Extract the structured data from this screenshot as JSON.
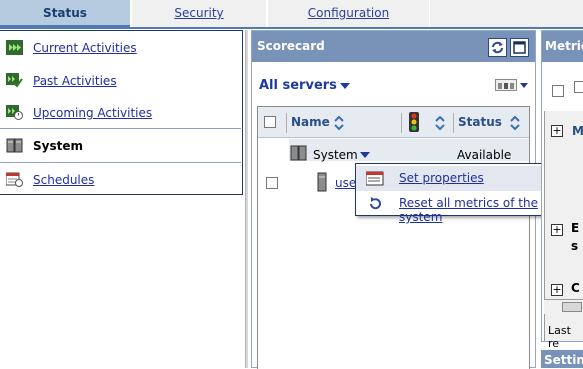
{
  "tabs": [
    {
      "label": "Status"
    },
    {
      "label": "Security"
    },
    {
      "label": "Configuration"
    }
  ],
  "nav": {
    "items": [
      {
        "label": "Current Activities",
        "icon": "current-activities-icon"
      },
      {
        "label": "Past Activities",
        "icon": "past-activities-icon"
      },
      {
        "label": "Upcoming Activities",
        "icon": "upcoming-activities-icon"
      },
      {
        "label": "System",
        "icon": "system-icon",
        "selected": true
      },
      {
        "label": "Schedules",
        "icon": "schedules-icon"
      }
    ]
  },
  "scorecard": {
    "title": "Scorecard",
    "servers_filter": "All servers",
    "columns": {
      "name": "Name",
      "status": "Status"
    },
    "rows": [
      {
        "name": "System",
        "status": "Available"
      },
      {
        "name": "use"
      }
    ]
  },
  "context_menu": {
    "items": [
      {
        "label": "Set properties"
      },
      {
        "label": "Reset all metrics of the system"
      }
    ]
  },
  "right_panel": {
    "title": "Metric",
    "row_letters": [
      "M",
      "E",
      "s",
      "C"
    ],
    "footer": "Last re",
    "settings_title": "Settin"
  },
  "colors": {
    "panel_header": "#7892b8",
    "active_tab": "#b6cbe0",
    "link": "#1f2f9f",
    "border_dark": "#1b3a6b"
  }
}
